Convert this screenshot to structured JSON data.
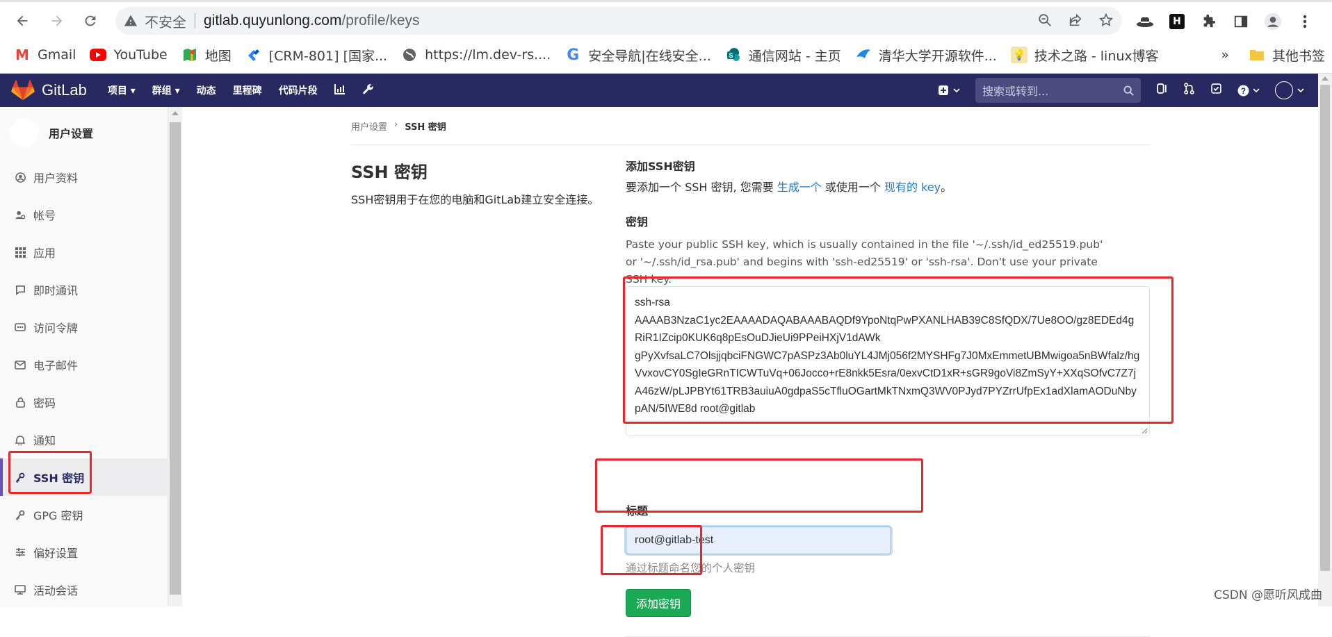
{
  "browser": {
    "insecure_label": "不安全",
    "url_host": "gitlab.quyunlong.com",
    "url_path": "/profile/keys",
    "bookmarks": [
      {
        "label": "Gmail",
        "icon": "gmail-icon"
      },
      {
        "label": "YouTube",
        "icon": "youtube-icon"
      },
      {
        "label": "地图",
        "icon": "maps-icon"
      },
      {
        "label": "[CRM-801] [国家...",
        "icon": "jira-icon"
      },
      {
        "label": "https://lm.dev-rs....",
        "icon": "globe-icon"
      },
      {
        "label": "安全导航|在线安全...",
        "icon": "google-icon"
      },
      {
        "label": "通信网站 - 主页",
        "icon": "sharepoint-icon"
      },
      {
        "label": "清华大学开源软件...",
        "icon": "tuna-icon"
      },
      {
        "label": "技术之路 - linux博客",
        "icon": "bulb-icon"
      }
    ],
    "more_bookmarks": "»",
    "other_bookmarks": "其他书签"
  },
  "gitlab": {
    "brand": "GitLab",
    "nav": [
      "项目 ▾",
      "群组 ▾",
      "动态",
      "里程碑",
      "代码片段"
    ],
    "search_placeholder": "搜索或转到..."
  },
  "sidebar": {
    "title": "用户设置",
    "items": [
      {
        "label": "用户资料",
        "icon": "profile-icon"
      },
      {
        "label": "帐号",
        "icon": "account-icon"
      },
      {
        "label": "应用",
        "icon": "applications-icon"
      },
      {
        "label": "即时通讯",
        "icon": "chat-icon"
      },
      {
        "label": "访问令牌",
        "icon": "token-icon"
      },
      {
        "label": "电子邮件",
        "icon": "email-icon"
      },
      {
        "label": "密码",
        "icon": "lock-icon"
      },
      {
        "label": "通知",
        "icon": "bell-icon"
      },
      {
        "label": "SSH 密钥",
        "icon": "key-icon"
      },
      {
        "label": "GPG 密钥",
        "icon": "key-icon"
      },
      {
        "label": "偏好设置",
        "icon": "preferences-icon"
      },
      {
        "label": "活动会话",
        "icon": "sessions-icon"
      }
    ],
    "active_index": 8
  },
  "main": {
    "breadcrumb": [
      "用户设置",
      "SSH 密钥"
    ],
    "heading": "SSH 密钥",
    "description": "SSH密钥用于在您的电脑和GitLab建立安全连接。",
    "add_heading": "添加SSH密钥",
    "add_text_pre": "要添加一个 SSH 密钥, 您需要 ",
    "add_link_generate": "生成一个",
    "add_text_mid": " 或使用一个 ",
    "add_link_existing": "现有的 key",
    "add_text_post": "。",
    "key_label": "密钥",
    "key_help": "Paste your public SSH key, which is usually contained in the file '~/.ssh/id_ed25519.pub' or '~/.ssh/id_rsa.pub' and begins with 'ssh-ed25519' or 'ssh-rsa'. Don't use your private SSH key.",
    "key_value": "ssh-rsa\nAAAAB3NzaC1yc2EAAAADAQABAAABAQDf9YpoNtqPwPXANLHAB39C8SfQDX/7Ue8OO/gz8EDEd4gRiR1IZcip0KUK6q8pEsOuDJieUi9PPeiHXjV1dAWk\ngPyXvfsaLC7OlsjjqbciFNGWC7pASPz3Ab0luYL4JMj056f2MYSHFg7J0MxEmmetUBMwigoa5nBWfalz/hgVvxovCY0SgIeGRnTICWTuVq+06Jocco+rE8nkk5Esra/0exvCtD1xR+sGR9goVi8ZmSyY+XXqSOfvC7Z7jA46zW/pLJPBYt61TRB3auiuA0gdpaS5cTfluOGartMkTNxmQ3WV0PJyd7PYZrrUfpEx1adXlamAODuNbypAN/5IWE8d root@gitlab",
    "title_label": "标题",
    "title_value": "root@gitlab-test",
    "title_help": "通过标题命名您的个人密钥",
    "add_button": "添加密钥"
  },
  "watermark": "CSDN @愿听风成曲",
  "colors": {
    "header": "#292961",
    "button": "#1aaa55",
    "annotation": "#e8262a",
    "link": "#1f78d1"
  }
}
